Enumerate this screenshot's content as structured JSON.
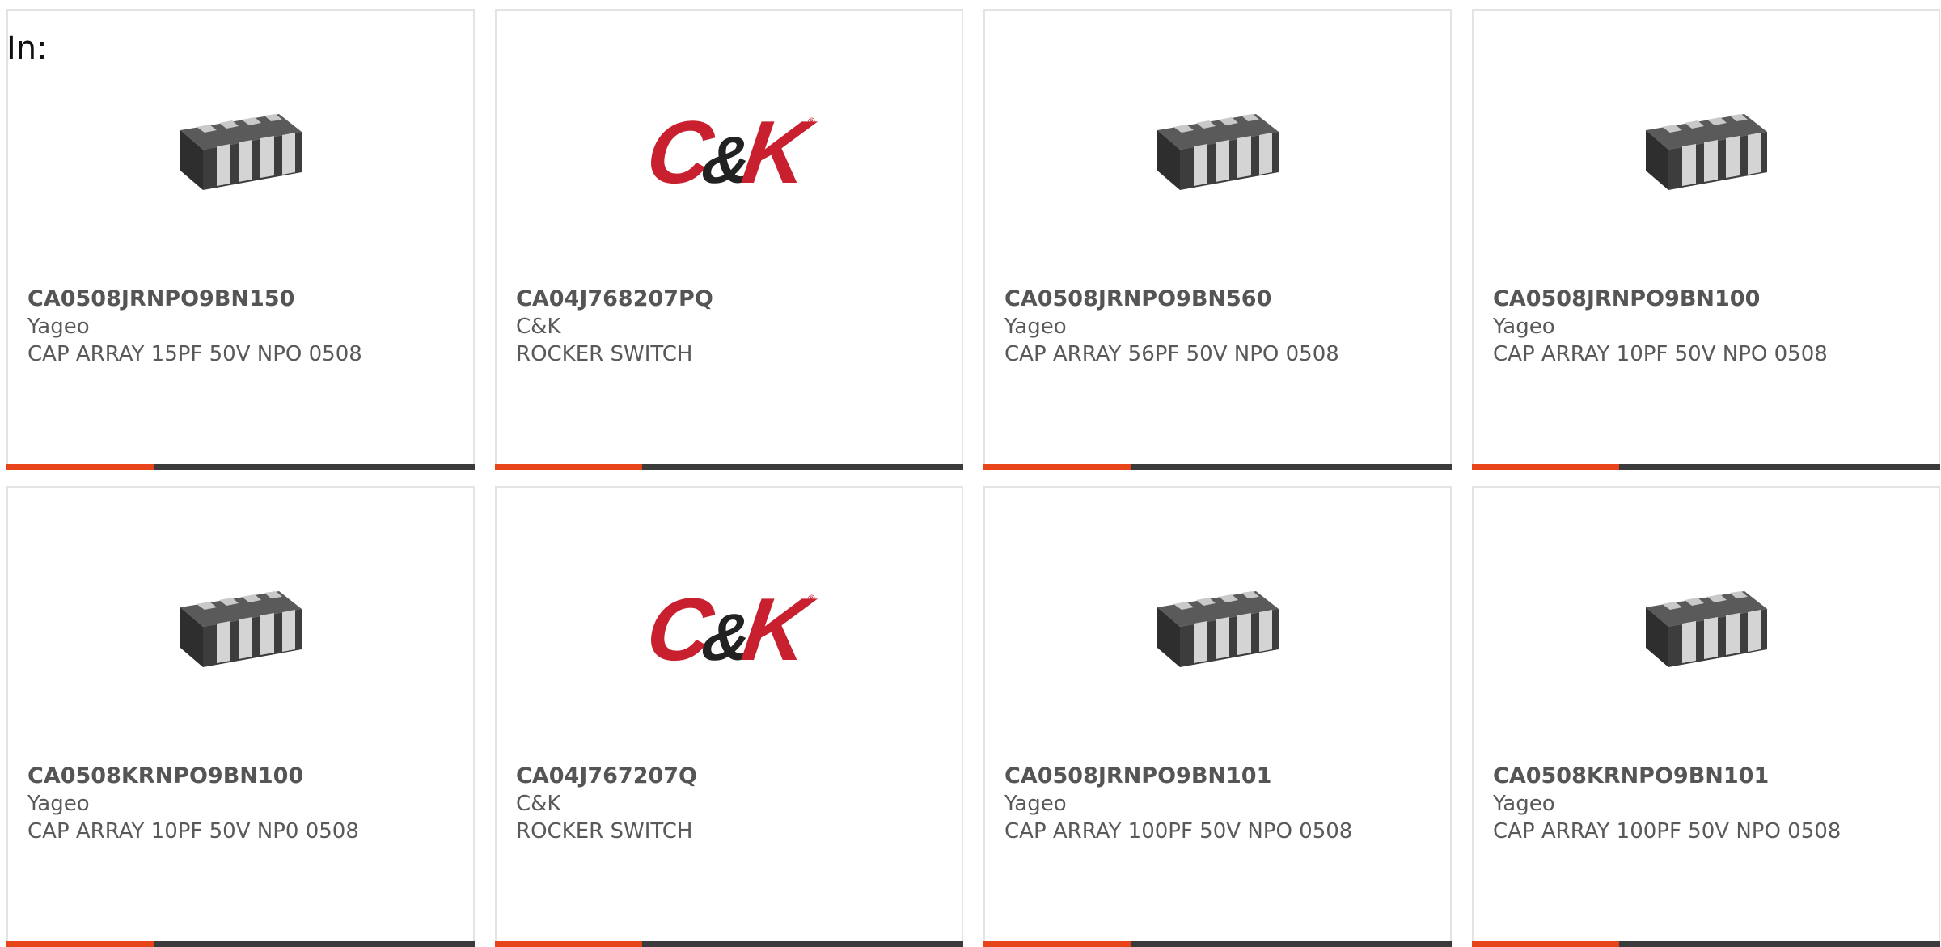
{
  "filter_label": "In:",
  "colors": {
    "accent": "#e8441a",
    "bar": "#3b3b3b",
    "border": "#e3e3e3",
    "text": "#595959",
    "logo_red": "#c8202f"
  },
  "products": [
    {
      "part_number": "CA0508JRNPO9BN150",
      "manufacturer": "Yageo",
      "description": "CAP ARRAY 15PF 50V NPO 0508",
      "image": "capacitor-array-chip-icon"
    },
    {
      "part_number": "CA04J768207PQ",
      "manufacturer": "C&K",
      "description": "ROCKER SWITCH",
      "image": "ck-logo",
      "logo_text_left": "C",
      "logo_text_amp": "&",
      "logo_text_right": "K"
    },
    {
      "part_number": "CA0508JRNPO9BN560",
      "manufacturer": "Yageo",
      "description": "CAP ARRAY 56PF 50V NPO 0508",
      "image": "capacitor-array-chip-icon"
    },
    {
      "part_number": "CA0508JRNPO9BN100",
      "manufacturer": "Yageo",
      "description": "CAP ARRAY 10PF 50V NPO 0508",
      "image": "capacitor-array-chip-icon"
    },
    {
      "part_number": "CA0508KRNPO9BN100",
      "manufacturer": "Yageo",
      "description": "CAP ARRAY 10PF 50V NP0 0508",
      "image": "capacitor-array-chip-icon"
    },
    {
      "part_number": "CA04J767207Q",
      "manufacturer": "C&K",
      "description": "ROCKER SWITCH",
      "image": "ck-logo",
      "logo_text_left": "C",
      "logo_text_amp": "&",
      "logo_text_right": "K"
    },
    {
      "part_number": "CA0508JRNPO9BN101",
      "manufacturer": "Yageo",
      "description": "CAP ARRAY 100PF 50V NPO 0508",
      "image": "capacitor-array-chip-icon"
    },
    {
      "part_number": "CA0508KRNPO9BN101",
      "manufacturer": "Yageo",
      "description": "CAP ARRAY 100PF 50V NPO 0508",
      "image": "capacitor-array-chip-icon"
    }
  ]
}
